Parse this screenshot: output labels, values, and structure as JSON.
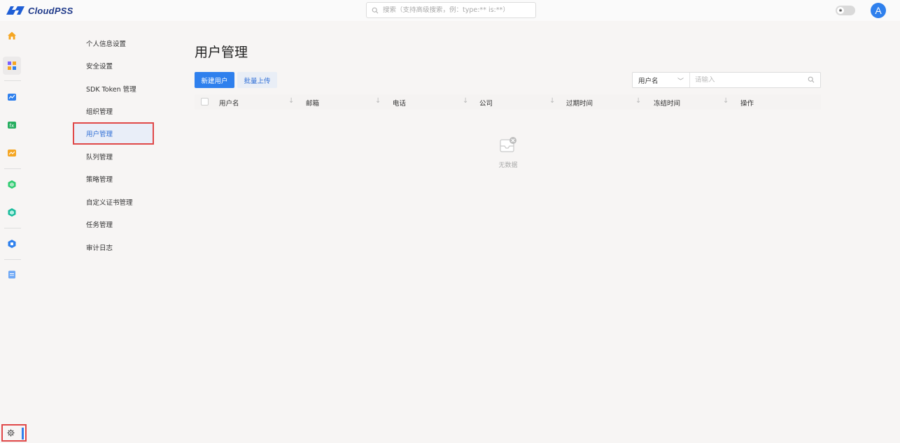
{
  "app": {
    "logo_text": "CloudPSS"
  },
  "search": {
    "placeholder": "搜索（支持高级搜索，例：type:** is:**）"
  },
  "user": {
    "avatar_letter": "A"
  },
  "settings_menu": {
    "items": [
      {
        "label": "个人信息设置"
      },
      {
        "label": "安全设置"
      },
      {
        "label": "SDK Token 管理"
      },
      {
        "label": "组织管理"
      },
      {
        "label": "用户管理",
        "active": true
      },
      {
        "label": "队列管理"
      },
      {
        "label": "策略管理"
      },
      {
        "label": "自定义证书管理"
      },
      {
        "label": "任务管理"
      },
      {
        "label": "审计日志"
      }
    ]
  },
  "main": {
    "title": "用户管理",
    "buttons": {
      "new_user": "新建用户",
      "batch_upload": "批量上传"
    },
    "filter": {
      "field": "用户名",
      "placeholder": "请输入"
    },
    "table": {
      "columns": [
        "用户名",
        "邮箱",
        "电话",
        "公司",
        "过期时间",
        "冻结时间",
        "操作"
      ],
      "empty_text": "无数据"
    }
  },
  "colors": {
    "accent": "#2f80ed",
    "highlight_border": "#e04848"
  },
  "icons": {
    "rail": [
      "home-icon",
      "apps-icon",
      "chart-icon",
      "formula-icon",
      "trend-icon",
      "hex-green-icon",
      "hex-teal-icon",
      "cube-blue-icon",
      "doc-icon",
      "gear-icon"
    ]
  }
}
